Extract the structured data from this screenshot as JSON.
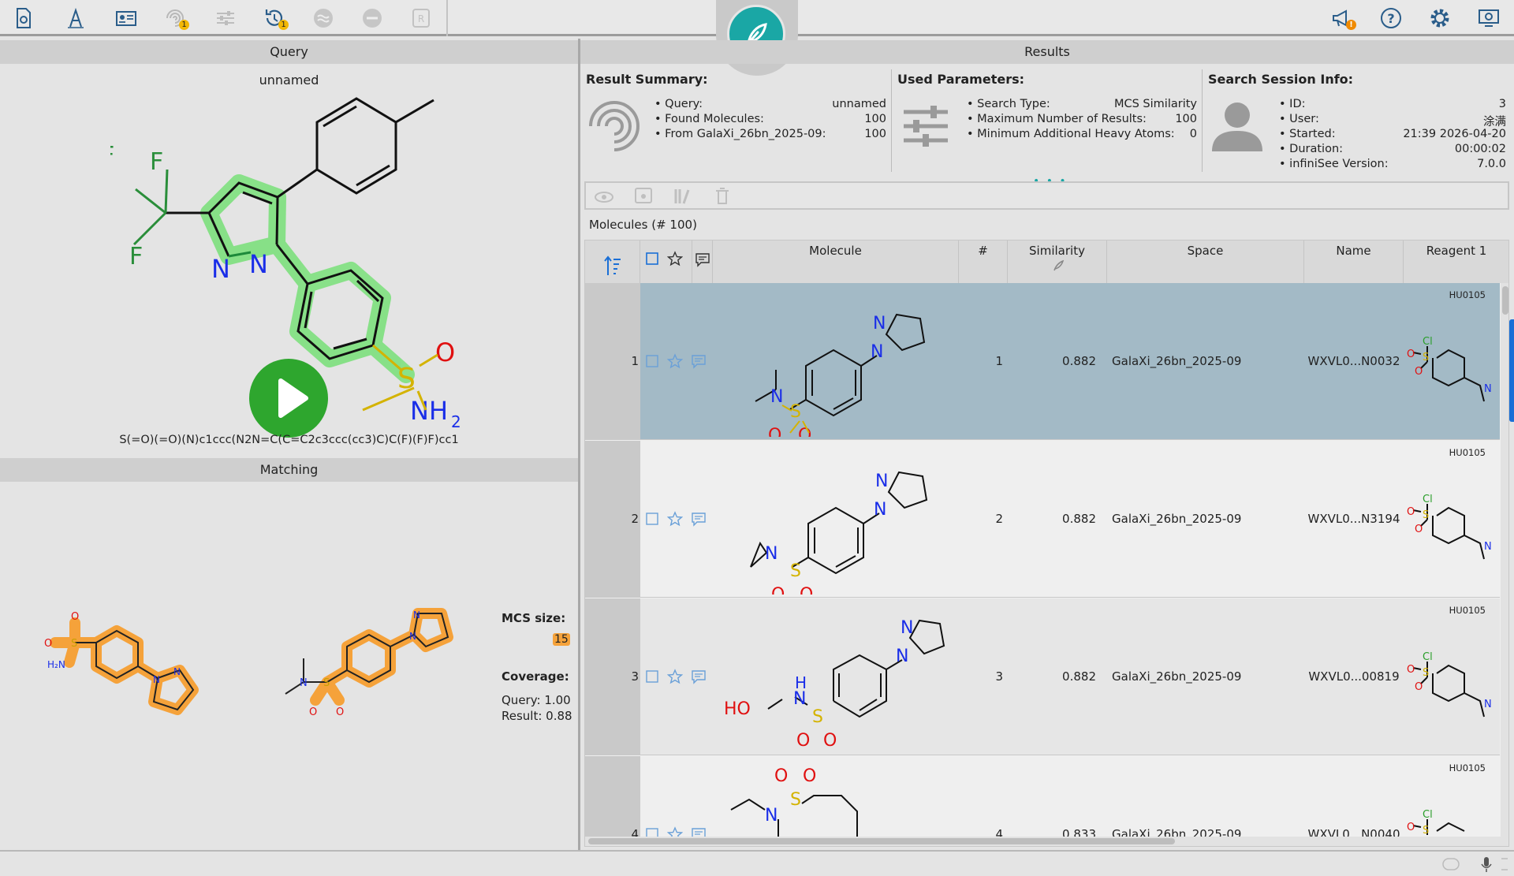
{
  "query": {
    "header": "Query",
    "name": "unnamed",
    "smiles": "S(=O)(=O)(N)c1ccc(N2N=C(C=C2c3ccc(cc3)C)C(F)(F)F)cc1"
  },
  "matching": {
    "header": "Matching",
    "mcs_label": "MCS size:",
    "mcs_value": "15",
    "coverage_label": "Coverage:",
    "coverage_query": "Query: 1.00",
    "coverage_result": "Result: 0.88"
  },
  "results": {
    "header": "Results",
    "summary": {
      "title": "Result Summary:",
      "items": [
        {
          "k": "Query:",
          "v": "unnamed"
        },
        {
          "k": "Found Molecules:",
          "v": "100"
        },
        {
          "k": "From GalaXi_26bn_2025-09:",
          "v": "100"
        }
      ]
    },
    "params": {
      "title": "Used Parameters:",
      "items": [
        {
          "k": "Search Type:",
          "v": "MCS Similarity"
        },
        {
          "k": "Maximum Number of Results:",
          "v": "100"
        },
        {
          "k": "Minimum Additional Heavy Atoms:",
          "v": "0"
        }
      ]
    },
    "session": {
      "title": "Search Session Info:",
      "items": [
        {
          "k": "ID:",
          "v": "3"
        },
        {
          "k": "User:",
          "v": "涂满"
        },
        {
          "k": "Started:",
          "v": "21:39 2026-04-20"
        },
        {
          "k": "Duration:",
          "v": "00:00:02"
        },
        {
          "k": "infiniSee Version:",
          "v": "7.0.0"
        }
      ]
    },
    "molecules_label": "Molecules (# 100)",
    "columns": {
      "molecule": "Molecule",
      "rank": "#",
      "similarity": "Similarity",
      "space": "Space",
      "name": "Name",
      "reagent": "Reagent 1"
    },
    "rows": [
      {
        "idx": "1",
        "rank": "1",
        "similarity": "0.882",
        "space": "GalaXi_26bn_2025-09",
        "name": "WXVL0...N0032",
        "reagent": "HU0105"
      },
      {
        "idx": "2",
        "rank": "2",
        "similarity": "0.882",
        "space": "GalaXi_26bn_2025-09",
        "name": "WXVL0...N3194",
        "reagent": "HU0105"
      },
      {
        "idx": "3",
        "rank": "3",
        "similarity": "0.882",
        "space": "GalaXi_26bn_2025-09",
        "name": "WXVL0...00819",
        "reagent": "HU0105"
      },
      {
        "idx": "4",
        "rank": "4",
        "similarity": "0.833",
        "space": "GalaXi_26bn_2025-09",
        "name": "WXVL0...N0040",
        "reagent": "HU0105"
      }
    ]
  },
  "colors": {
    "accent": "#1aa7a5",
    "selected_row": "#a3bac6",
    "highlight_green": "#7ee07e",
    "highlight_orange": "#f5a23a",
    "play": "#2ea62e"
  }
}
